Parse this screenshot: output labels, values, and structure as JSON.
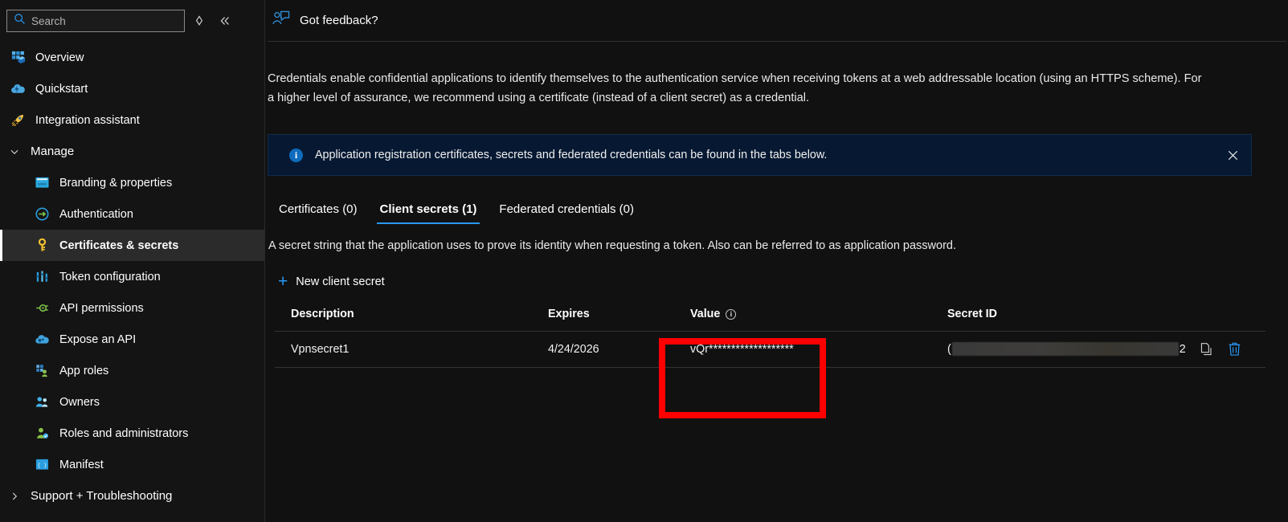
{
  "sidebar": {
    "search": {
      "placeholder": "Search",
      "value": "",
      "icon": "search-icon"
    },
    "sort_toggle_icon": "sort-diamond-icon",
    "collapse_icon": "double-chevron-left-icon",
    "items": [
      {
        "label": "Overview",
        "icon": "overview-grid-icon",
        "indent": false,
        "selected": false
      },
      {
        "label": "Quickstart",
        "icon": "quickstart-cloud-icon",
        "indent": false,
        "selected": false
      },
      {
        "label": "Integration assistant",
        "icon": "rocket-icon",
        "indent": false,
        "selected": false
      }
    ],
    "manage_group": {
      "label": "Manage",
      "expanded": true,
      "chevron": "chevron-down-icon"
    },
    "manage_items": [
      {
        "label": "Branding & properties",
        "icon": "branding-card-icon",
        "selected": false
      },
      {
        "label": "Authentication",
        "icon": "authentication-arrow-icon",
        "selected": false
      },
      {
        "label": "Certificates & secrets",
        "icon": "key-icon",
        "selected": true
      },
      {
        "label": "Token configuration",
        "icon": "token-sliders-icon",
        "selected": false
      },
      {
        "label": "API permissions",
        "icon": "api-permissions-icon",
        "selected": false
      },
      {
        "label": "Expose an API",
        "icon": "expose-api-cloud-icon",
        "selected": false
      },
      {
        "label": "App roles",
        "icon": "app-roles-icon",
        "selected": false
      },
      {
        "label": "Owners",
        "icon": "owners-people-icon",
        "selected": false
      },
      {
        "label": "Roles and administrators",
        "icon": "roles-admin-icon",
        "selected": false
      },
      {
        "label": "Manifest",
        "icon": "manifest-braces-icon",
        "selected": false
      }
    ],
    "support_group": {
      "label": "Support + Troubleshooting",
      "expanded": false,
      "chevron": "chevron-right-icon"
    }
  },
  "main": {
    "feedback": {
      "label": "Got feedback?",
      "icon": "feedback-person-icon"
    },
    "description": "Credentials enable confidential applications to identify themselves to the authentication service when receiving tokens at a web addressable location (using an HTTPS scheme). For a higher level of assurance, we recommend using a certificate (instead of a client secret) as a credential.",
    "banner": {
      "icon": "info-circle-icon",
      "text": "Application registration certificates, secrets and federated credentials can be found in the tabs below.",
      "close_icon": "close-icon",
      "background_color": "#071932",
      "icon_color": "#0f6cbd"
    },
    "tabs": [
      {
        "label": "Certificates (0)",
        "active": false
      },
      {
        "label": "Client secrets (1)",
        "active": true
      },
      {
        "label": "Federated credentials (0)",
        "active": false
      }
    ],
    "tab_accent_color": "#2899f5",
    "sub_description": "A secret string that the application uses to prove its identity when requesting a token. Also can be referred to as application password.",
    "new_secret_button": {
      "label": "New client secret",
      "icon": "plus-icon"
    },
    "table": {
      "columns": [
        "Description",
        "Expires",
        "Value",
        "Secret ID"
      ],
      "value_header_icon": "info-circle-outline-icon",
      "rows": [
        {
          "description": "Vpnsecret1",
          "expires": "4/24/2026",
          "value": "vQr*******************",
          "secret_id_prefix": "(",
          "secret_id_redacted": true,
          "secret_id_suffix": "2",
          "copy_icon": "copy-icon",
          "delete_icon": "delete-trash-icon"
        }
      ]
    },
    "annotation": {
      "type": "rectangle",
      "color": "#ff0000",
      "target": "Value column"
    }
  }
}
